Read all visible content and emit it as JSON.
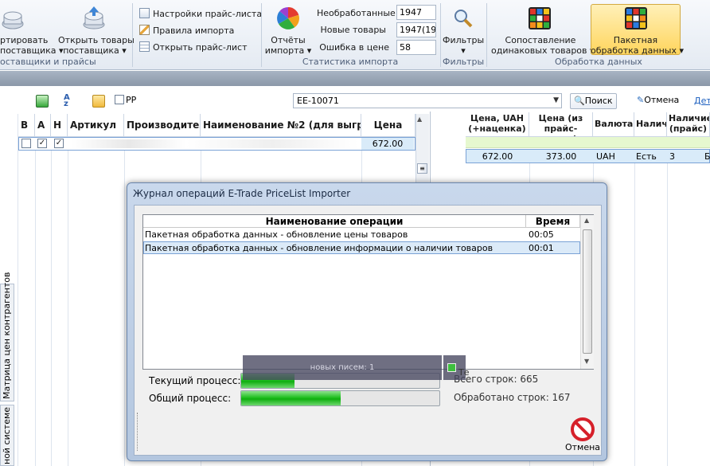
{
  "ribbon": {
    "export_label": "ртировать",
    "export_sub": "поставщика",
    "open_goods_label": "Открыть товары",
    "open_goods_sub": "поставщика",
    "suppliers_group": "оставщики и прайсы",
    "price_settings": "Настройки прайс-листа",
    "import_rules": "Правила импорта",
    "open_price": "Открыть прайс-лист",
    "reports_label": "Отчёты",
    "reports_sub": "импорта",
    "unprocessed_label": "Необработанные",
    "unprocessed_value": "1947",
    "new_goods_label": "Новые товары",
    "new_goods_value": "1947(194",
    "price_error_label": "Ошибка в цене",
    "price_error_value": "58",
    "stats_group": "Статистика импорта",
    "filters_label": "Фильтры",
    "filters_group": "Фильтры",
    "compare_label": "Сопоставление",
    "compare_sub": "одинаковых товаров",
    "batch_label": "Пакетная",
    "batch_sub": "обработка данных",
    "data_group": "Обработка данных"
  },
  "toolbar": {
    "pp_label": "PP",
    "search_value": "EE-10071",
    "search_button": "Поиск",
    "cancel_button": "Отмена",
    "det_label": "Дет"
  },
  "left_grid": {
    "headers": [
      "В",
      "А",
      "Н",
      "Артикул",
      "Производитель",
      "Наименование №2 (для выгрузк",
      "Цена"
    ],
    "row": {
      "checked": [
        "",
        "✓",
        "✓"
      ],
      "price": "672.00"
    }
  },
  "right_grid": {
    "headers": [
      "Цена, UAH\n(+наценка)",
      "Цена (из\nпрайс-листа)",
      "Валюта",
      "Наличи",
      "Наличие\n(прайс)"
    ],
    "row": [
      "672.00",
      "373.00",
      "UAH",
      "Есть",
      "3",
      "Б"
    ]
  },
  "side_tabs": {
    "tab1": "Матрица цен контрагентов",
    "tab2": "ной системе"
  },
  "dialog": {
    "title": "Журнал операций E-Trade PriceList Importer",
    "col_name": "Наименование операции",
    "col_time": "Время",
    "rows": [
      {
        "name": "Пакетная обработка данных - обновление цены товаров",
        "time": "00:05"
      },
      {
        "name": "Пакетная обработка данных - обновление информации о наличии товаров",
        "time": "00:01"
      }
    ],
    "current_label": "Текущий процесс:",
    "total_label": "Общий процесс:",
    "current_progress": 0.27,
    "total_progress": 0.5,
    "total_rows": "Всего строк: 665",
    "processed_rows": "Обработано строк: 167",
    "cancel_label": "Отмена"
  },
  "notification": {
    "text": "новых писем: 1",
    "side_text": "Те"
  }
}
